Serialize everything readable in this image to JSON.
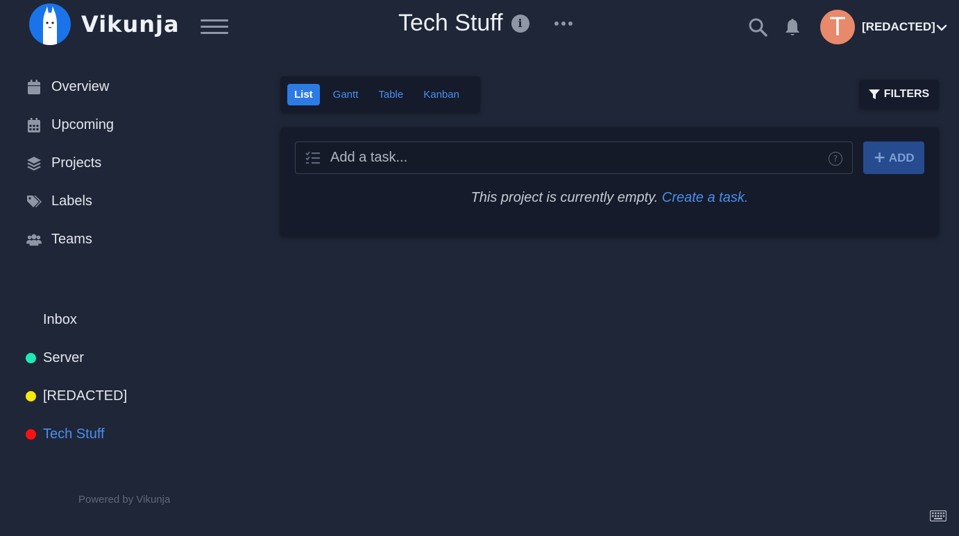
{
  "app": {
    "name": "Vikunja"
  },
  "header": {
    "title": "Tech Stuff",
    "user_initial": "T",
    "user_name": "[REDACTED]"
  },
  "sidebar": {
    "nav": [
      {
        "label": "Overview",
        "icon": "calendar-icon"
      },
      {
        "label": "Upcoming",
        "icon": "calendar-grid-icon"
      },
      {
        "label": "Projects",
        "icon": "layers-icon"
      },
      {
        "label": "Labels",
        "icon": "tags-icon"
      },
      {
        "label": "Teams",
        "icon": "users-icon"
      }
    ],
    "projects": [
      {
        "label": "Inbox",
        "color": ""
      },
      {
        "label": "Server",
        "color": "#1de9b6"
      },
      {
        "label": "[REDACTED]",
        "color": "#f5e90b"
      },
      {
        "label": "Tech Stuff",
        "color": "#ff1111"
      }
    ],
    "powered_by": "Powered by Vikunja"
  },
  "views": {
    "tabs": [
      "List",
      "Gantt",
      "Table",
      "Kanban"
    ],
    "active": "List"
  },
  "filters": {
    "label": "FILTERS"
  },
  "task_input": {
    "placeholder": "Add a task...",
    "help": "?"
  },
  "add_button": {
    "label": "ADD"
  },
  "empty_state": {
    "message": "This project is currently empty.",
    "link": "Create a task."
  },
  "colors": {
    "accent": "#2c7be5",
    "background": "#1f2637",
    "card": "#151b2a",
    "avatar": "#e8896b"
  }
}
